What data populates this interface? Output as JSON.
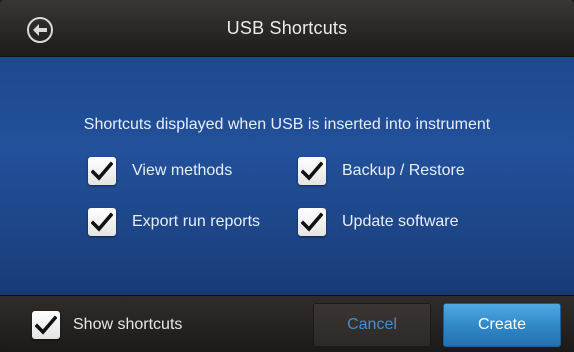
{
  "header": {
    "title": "USB Shortcuts",
    "back_icon": "back-arrow-circle-icon"
  },
  "main": {
    "intro": "Shortcuts displayed when USB is inserted into instrument",
    "options": [
      {
        "label": "View methods",
        "checked": true
      },
      {
        "label": "Backup / Restore",
        "checked": true
      },
      {
        "label": "Export run reports",
        "checked": true
      },
      {
        "label": "Update software",
        "checked": true
      }
    ]
  },
  "footer": {
    "show_shortcuts_label": "Show shortcuts",
    "show_shortcuts_checked": true,
    "cancel_label": "Cancel",
    "create_label": "Create"
  },
  "colors": {
    "header_bg": "#2a2725",
    "content_bg": "#22509a",
    "footer_bg": "#242220",
    "cancel_text": "#3f8fd6",
    "create_bg": "#2f86c7"
  }
}
